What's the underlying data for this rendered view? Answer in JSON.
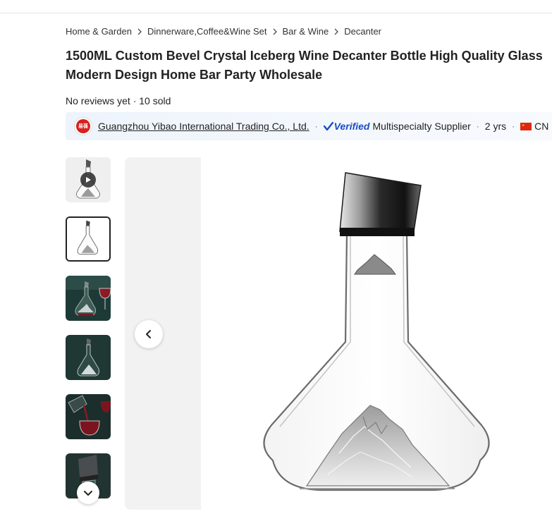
{
  "breadcrumb": [
    "Home & Garden",
    "Dinnerware,Coffee&Wine Set",
    "Bar & Wine",
    "Decanter"
  ],
  "product": {
    "title_line1": "1500ML Custom Bevel Crystal Iceberg Wine Decanter Bottle High Quality Glass",
    "title_line2": "Modern Design Home Bar Party Wholesale",
    "reviews": "No reviews yet",
    "sold": "10 sold"
  },
  "supplier": {
    "logo_text": "易葆",
    "name": "Guangzhou Yibao International Trading Co., Ltd.",
    "verified_label": "Verified",
    "type": "Multispecialty Supplier",
    "years": "2 yrs",
    "country": "CN",
    "separator": "·"
  },
  "gallery": {
    "thumbnails": [
      {
        "icon": "decanter-video-thumbnail",
        "has_video": true
      },
      {
        "icon": "decanter-white-thumbnail",
        "selected": true
      },
      {
        "icon": "decanter-wine-glass-thumbnail"
      },
      {
        "icon": "decanter-dark-thumbnail"
      },
      {
        "icon": "pouring-wine-thumbnail"
      },
      {
        "icon": "decanter-stopper-thumbnail"
      }
    ],
    "main_image": "iceberg-decanter-image",
    "prev_icon": "chevron-left-icon",
    "down_icon": "chevron-down-icon"
  },
  "colors": {
    "verified": "#1a4dc4",
    "supplier_bar_bg": "#eef4fc",
    "viewer_bg": "#f2f2f2"
  }
}
